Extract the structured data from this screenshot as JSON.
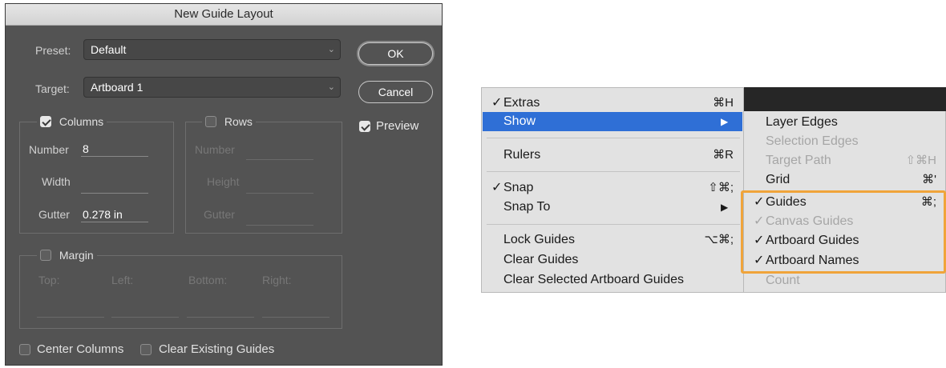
{
  "dialog": {
    "title": "New Guide Layout",
    "preset_label": "Preset:",
    "preset_value": "Default",
    "target_label": "Target:",
    "target_value": "Artboard 1",
    "ok_label": "OK",
    "cancel_label": "Cancel",
    "preview_label": "Preview",
    "preview_checked": true,
    "columns": {
      "label": "Columns",
      "checked": true,
      "number_label": "Number",
      "number_value": "8",
      "width_label": "Width",
      "width_value": "",
      "gutter_label": "Gutter",
      "gutter_value": "0.278 in"
    },
    "rows": {
      "label": "Rows",
      "checked": false,
      "number_label": "Number",
      "height_label": "Height",
      "gutter_label": "Gutter"
    },
    "margin": {
      "label": "Margin",
      "checked": false,
      "top_label": "Top:",
      "left_label": "Left:",
      "bottom_label": "Bottom:",
      "right_label": "Right:"
    },
    "center_columns_label": "Center Columns",
    "clear_existing_label": "Clear Existing Guides"
  },
  "view_menu": {
    "check_mark": "✓",
    "items": [
      {
        "label": "Extras",
        "shortcut": "⌘H",
        "checked": true
      },
      {
        "label": "Show",
        "highlighted": true,
        "submenu_arrow": "▶"
      },
      {
        "label": "Rulers",
        "shortcut": "⌘R"
      },
      {
        "label": "Snap",
        "shortcut": "⇧⌘;",
        "checked": true
      },
      {
        "label": "Snap To",
        "submenu_arrow": "▶"
      },
      {
        "label": "Lock Guides",
        "shortcut": "⌥⌘;"
      },
      {
        "label": "Clear Guides"
      },
      {
        "label": "Clear Selected Artboard Guides"
      }
    ]
  },
  "show_submenu": {
    "items": [
      {
        "label": "Layer Edges"
      },
      {
        "label": "Selection Edges",
        "disabled": true
      },
      {
        "label": "Target Path",
        "shortcut": "⇧⌘H",
        "disabled": true
      },
      {
        "label": "Grid",
        "shortcut": "⌘'"
      },
      {
        "label": "Guides",
        "shortcut": "⌘;",
        "checked": true
      },
      {
        "label": "Canvas Guides",
        "checked": true,
        "disabled": true
      },
      {
        "label": "Artboard Guides",
        "checked": true
      },
      {
        "label": "Artboard Names",
        "checked": true
      },
      {
        "label": "Count",
        "disabled": true
      }
    ]
  },
  "colors": {
    "dialog_bg": "#535353",
    "menu_bg": "#e2e2e2",
    "menu_highlight": "#2f6fd6",
    "annotation_box": "#f0a43a"
  }
}
